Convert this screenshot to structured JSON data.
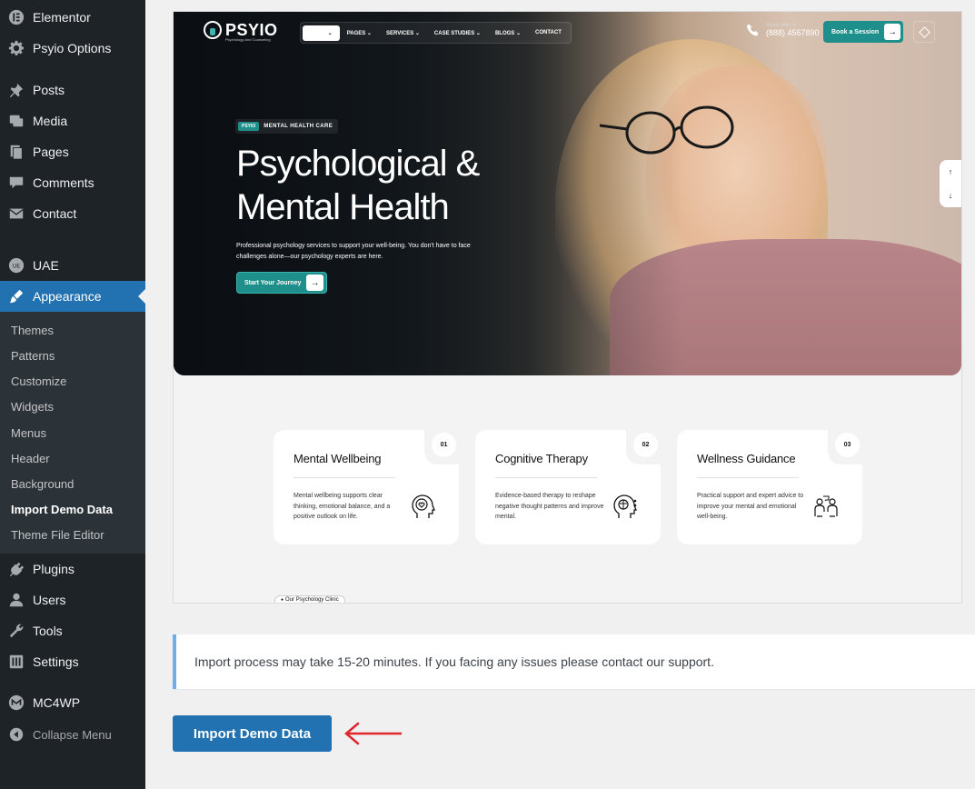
{
  "sidebar": {
    "items": [
      {
        "label": "Elementor",
        "icon": "elementor-icon"
      },
      {
        "label": "Psyio Options",
        "icon": "gear-icon"
      },
      {
        "label": "Posts",
        "icon": "pin-icon"
      },
      {
        "label": "Media",
        "icon": "media-icon"
      },
      {
        "label": "Pages",
        "icon": "pages-icon"
      },
      {
        "label": "Comments",
        "icon": "comment-icon"
      },
      {
        "label": "Contact",
        "icon": "mail-icon"
      },
      {
        "label": "UAE",
        "icon": "uae-icon"
      },
      {
        "label": "Appearance",
        "icon": "brush-icon"
      },
      {
        "label": "Plugins",
        "icon": "plug-icon"
      },
      {
        "label": "Users",
        "icon": "user-icon"
      },
      {
        "label": "Tools",
        "icon": "wrench-icon"
      },
      {
        "label": "Settings",
        "icon": "settings-icon"
      },
      {
        "label": "MC4WP",
        "icon": "mc4wp-icon"
      },
      {
        "label": "Collapse Menu",
        "icon": "collapse-icon"
      }
    ],
    "submenu": [
      "Themes",
      "Patterns",
      "Customize",
      "Widgets",
      "Menus",
      "Header",
      "Background",
      "Import Demo Data",
      "Theme File Editor"
    ]
  },
  "preview": {
    "logo": "PSYIO",
    "logo_sub": "Psychology And Counseling",
    "nav": [
      "HOME",
      "PAGES",
      "SERVICES",
      "CASE STUDIES",
      "BLOGS",
      "CONTACT"
    ],
    "phone_label": "Speak With Us",
    "phone": "(888) 4567890",
    "book_button": "Book a Session",
    "tag_pill": "PSYIO",
    "tag_text": "MENTAL HEALTH CARE",
    "headline_1": "Psychological &",
    "headline_2": "Mental Health",
    "lead": "Professional psychology services to support your well-being. You don't have to face challenges alone—our psychology experts are here.",
    "cta": "Start Your Journey",
    "cards": [
      {
        "num": "01",
        "title": "Mental Wellbeing",
        "desc": "Mental wellbeing supports clear thinking, emotional balance, and a positive outlook on life.",
        "icon": "head-heart-icon"
      },
      {
        "num": "02",
        "title": "Cognitive Therapy",
        "desc": "Evidence-based therapy to reshape negative thought patterns and improve mental.",
        "icon": "head-brain-icon"
      },
      {
        "num": "03",
        "title": "Wellness Guidance",
        "desc": "Practical support and expert advice to improve your mental and emotional well-being.",
        "icon": "counseling-icon"
      }
    ],
    "clinic_badge": "Our Psychology Clinic"
  },
  "notice": "Import process may take 15-20 minutes. If you facing any issues please contact our support.",
  "import_button": "Import Demo Data",
  "colors": {
    "accent": "#2271b1",
    "sidebar": "#1d2327",
    "teal": "#1e8f8a",
    "arrow": "#e0252b"
  }
}
